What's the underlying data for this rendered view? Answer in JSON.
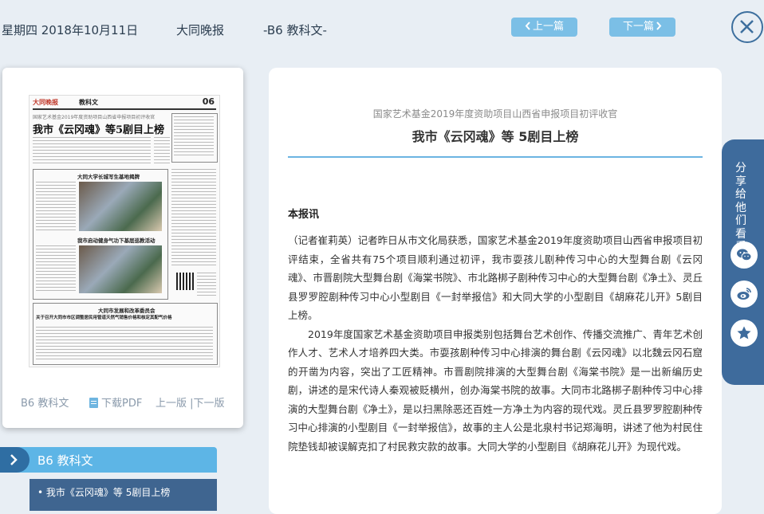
{
  "header": {
    "date": "星期四 2018年10月11日",
    "paper_name": "大同晚报",
    "page_section": "-B6 教科文-",
    "prev_label": "上一篇",
    "next_label": "下一篇",
    "close_icon": "close-icon"
  },
  "thumbnail": {
    "masthead_logo": "大同晚报",
    "masthead_section": "教科文",
    "page_number": "06",
    "kicker": "国家艺术基金2019年度资助项目山西省申报项目初评收官",
    "headline": "我市《云冈魂》等5剧目上榜",
    "box1_title": "大同大学长城写生基地揭牌",
    "box2_title": "我市启动健身气功下基层巡教活动",
    "bottom_title": "大同市发展和改革委员会",
    "bottom_subtitle": "关于召开大同市市区调整居民用管道天然气销售价格和核定其配气价格",
    "links": {
      "section": "B6 教科文",
      "download_pdf": "下载PDF",
      "prev_page": "上一版",
      "separator": "|",
      "next_page": "下一版"
    }
  },
  "section_menu": {
    "title": "B6 教科文",
    "items": [
      {
        "label": "• 我市《云冈魂》等 5剧目上榜"
      }
    ]
  },
  "article": {
    "kicker": "国家艺术基金2019年度资助项目山西省申报项目初评收官",
    "title": "我市《云冈魂》等 5剧目上榜",
    "lead": "本报讯",
    "paragraphs": [
      "（记者崔莉英）记者昨日从市文化局获悉，国家艺术基金2019年度资助项目山西省申报项目初评结束，全省共有75个项目顺利通过初评，我市耍孩儿剧种传习中心的大型舞台剧《云冈魂》、市晋剧院大型舞台剧《海棠书院》、市北路梆子剧种传习中心的大型舞台剧《净土》、灵丘县罗罗腔剧种传习中心小型剧目《一封举报信》和大同大学的小型剧目《胡麻花儿开》5剧目上榜。",
      "2019年度国家艺术基金资助项目申报类别包括舞台艺术创作、传播交流推广、青年艺术创作人才、艺术人才培养四大类。市耍孩剧种传习中心排演的舞台剧《云冈魂》以北魏云冈石窟的开凿为内容，突出了工匠精神。市晋剧院排演的大型舞台剧《海棠书院》是一出新编历史剧，讲述的是宋代诗人秦观被贬横州，创办海棠书院的故事。大同市北路梆子剧种传习中心排演的大型舞台剧《净土》，是以扫黑除恶还百姓一方净土为内容的现代戏。灵丘县罗罗腔剧种传习中心排演的小型剧目《一封举报信》，故事的主人公是北泉村书记郑海明，讲述了他为村民住院垫钱却被误解克扣了村民救灾款的故事。大同大学的小型剧目《胡麻花儿开》为现代戏。"
    ]
  },
  "share": {
    "label": "分享给他们看看",
    "buttons": [
      {
        "icon": "wechat-icon"
      },
      {
        "icon": "weibo-icon"
      },
      {
        "icon": "favorite-star-icon"
      }
    ]
  },
  "colors": {
    "accent": "#5db5e6",
    "nav_button": "#7bbfe6",
    "dark_blue": "#3e6b9c",
    "background": "#e8eef4"
  }
}
